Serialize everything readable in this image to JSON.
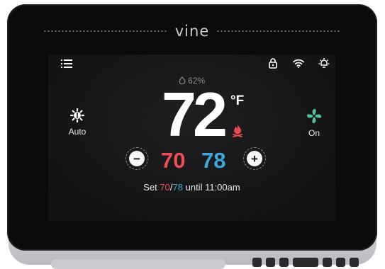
{
  "device": {
    "brand": "vine"
  },
  "status_bar": {
    "menu_icon": "menu-icon",
    "lock_icon": "lock-icon",
    "wifi_icon": "wifi-icon",
    "light_icon": "light-icon"
  },
  "readings": {
    "humidity": "62%",
    "temperature": "72",
    "unit": "°F",
    "activity_icon": "flame-icon",
    "activity_color": "#e94a4f"
  },
  "mode": {
    "icon": "heat-cool-icon",
    "label": "Auto"
  },
  "fan": {
    "icon": "fan-icon",
    "label": "On",
    "color": "#52c39b"
  },
  "setpoints": {
    "decrease_symbol": "−",
    "increase_symbol": "+",
    "heat": "70",
    "cool": "78",
    "heat_color": "#ee4f55",
    "cool_color": "#3ba9dc"
  },
  "schedule": {
    "prefix": "Set",
    "heat": "70",
    "separator": "/",
    "cool": "78",
    "suffix": "until 11:00am"
  }
}
